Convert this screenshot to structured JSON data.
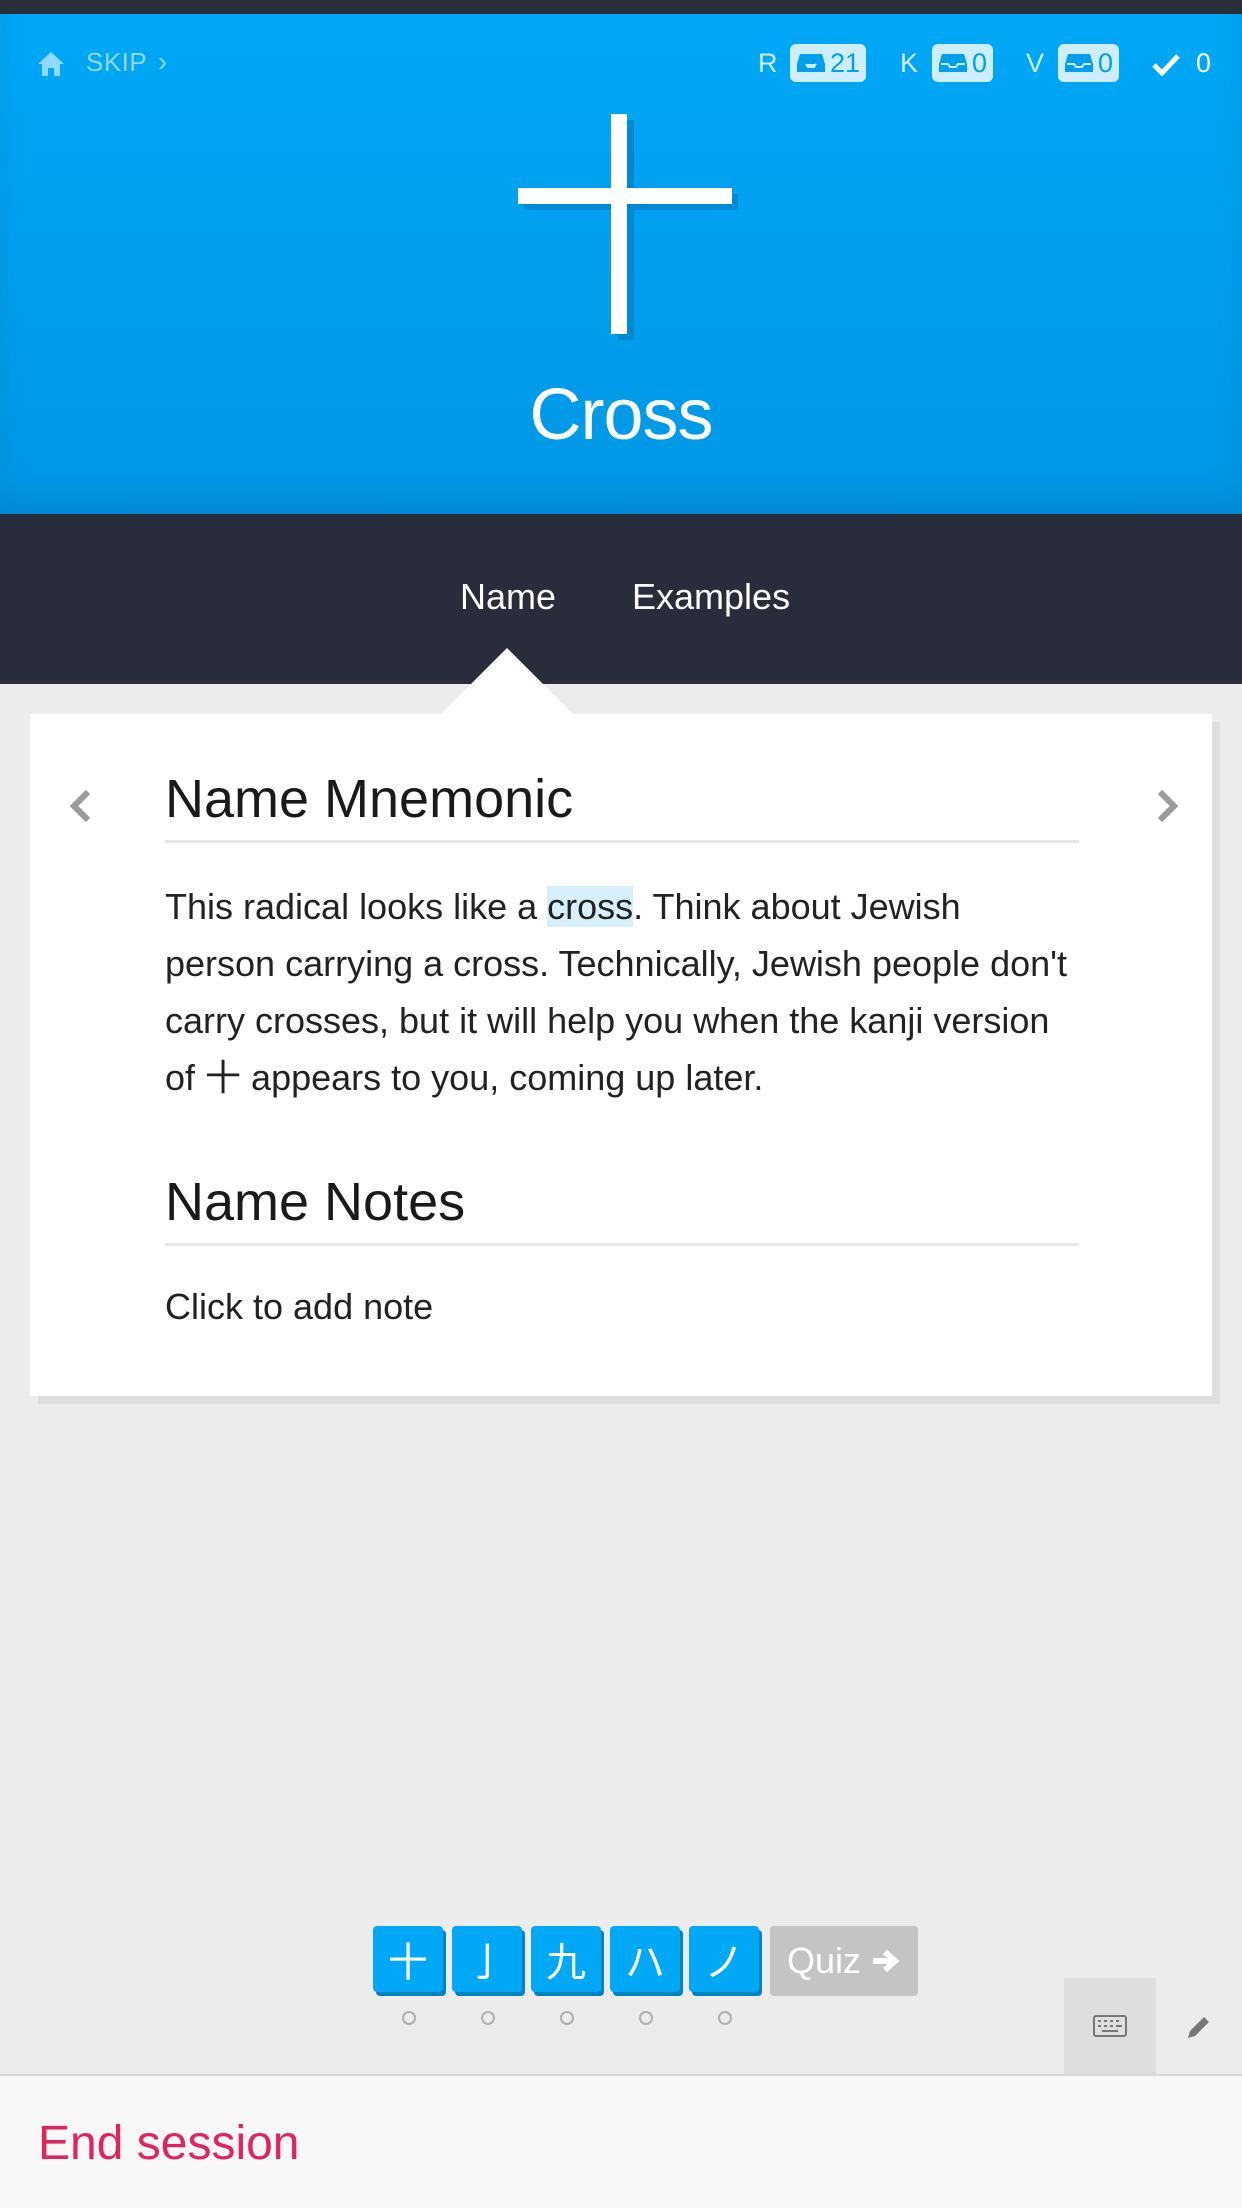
{
  "topbar": {
    "home_icon": "home-icon",
    "skip_label": "SKIP",
    "skip_chevron": "›",
    "counts": [
      {
        "letter": "R",
        "value": "21"
      },
      {
        "letter": "K",
        "value": "0"
      },
      {
        "letter": "V",
        "value": "0"
      }
    ],
    "done_count": "0"
  },
  "subject": {
    "character": "十",
    "meaning": "Cross"
  },
  "tabs": {
    "name": "Name",
    "examples": "Examples"
  },
  "card": {
    "mnemonic_title": "Name Mnemonic",
    "mnemonic_before": "This radical looks like a ",
    "mnemonic_highlight": "cross",
    "mnemonic_after": ". Think about Jewish person carrying a cross. Technically, Jewish people don't carry crosses, but it will help you when the kanji version of ",
    "mnemonic_char": "十",
    "mnemonic_end": " appears to you, coming up later.",
    "notes_title": "Name Notes",
    "notes_placeholder": "Click to add note"
  },
  "stack": {
    "items": [
      "十",
      "亅",
      "九",
      "ハ",
      "ノ"
    ],
    "quiz_label": "Quiz"
  },
  "footer": {
    "end_session": "End session"
  },
  "colors": {
    "hero": "#00a8f6",
    "tabbar": "#292c3b",
    "end_session": "#e0245e"
  }
}
